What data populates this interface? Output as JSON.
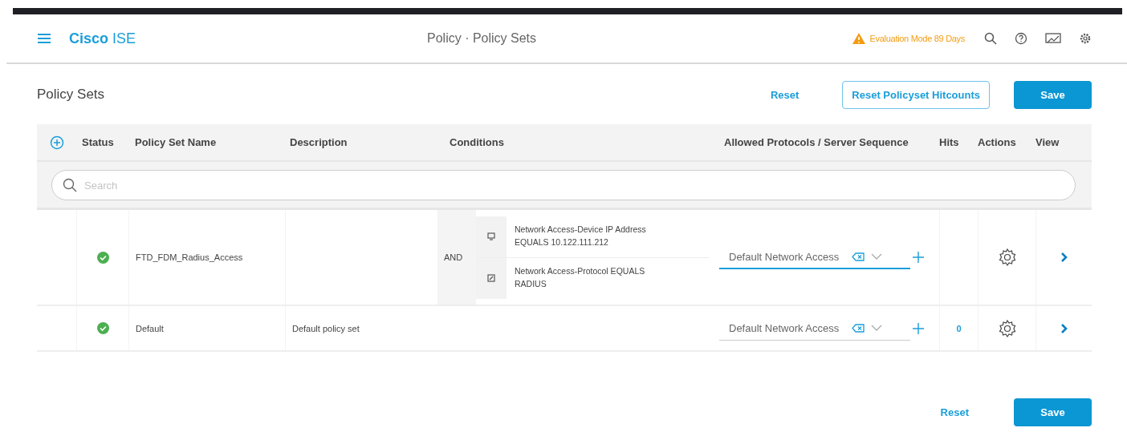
{
  "header": {
    "brand_bold": "Cisco",
    "brand_light": "ISE",
    "breadcrumb": "Policy · Policy Sets",
    "warning": "Evaluation Mode 89 Days"
  },
  "page": {
    "title": "Policy Sets",
    "reset": "Reset",
    "reset_hitcounts": "Reset Policyset Hitcounts",
    "save": "Save"
  },
  "table": {
    "columns": [
      "Status",
      "Policy Set Name",
      "Description",
      "Conditions",
      "Allowed Protocols / Server Sequence",
      "Hits",
      "Actions",
      "View"
    ],
    "search": {
      "placeholder": "Search"
    },
    "rows": [
      {
        "enabled": true,
        "name": "FTD_FDM_Radius_Access",
        "description": "",
        "operator": "AND",
        "conditions": [
          {
            "kind": "device",
            "text": "Network Access-Device IP Address EQUALS 10.122.111.212"
          },
          {
            "kind": "protocol",
            "text": "Network Access-Protocol EQUALS RADIUS"
          }
        ],
        "protocol": "Default Network Access",
        "focused": true,
        "hits": ""
      },
      {
        "enabled": true,
        "name": "Default",
        "description": "Default policy set",
        "operator": "",
        "conditions": [],
        "protocol": "Default Network Access",
        "focused": false,
        "hits": "0"
      }
    ]
  },
  "footer": {
    "reset": "Reset",
    "save": "Save"
  }
}
